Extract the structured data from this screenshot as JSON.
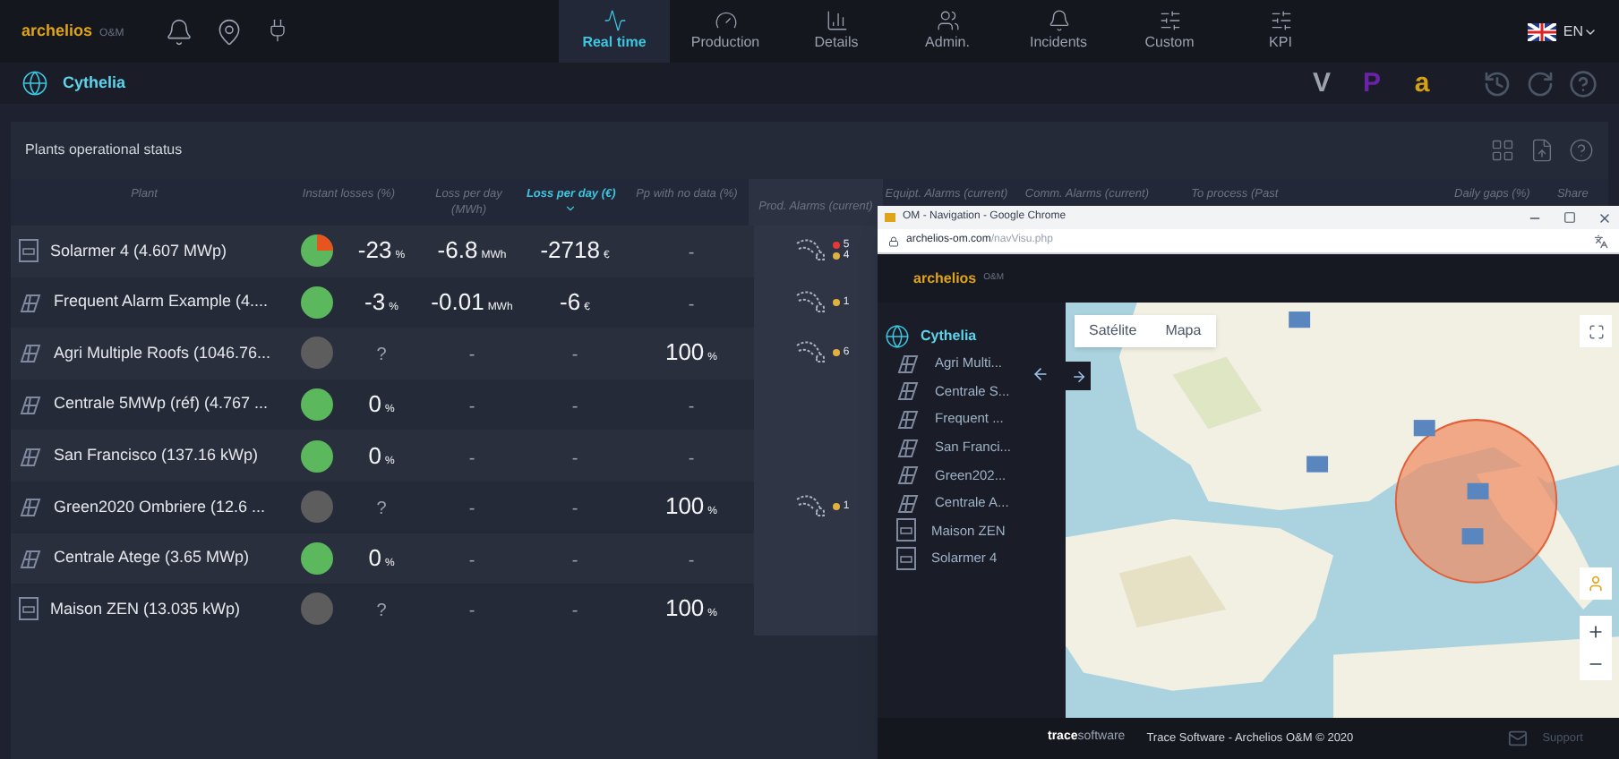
{
  "top_bar": {
    "logo": "archelios",
    "logo_suffix": "O&M",
    "tabs": [
      {
        "label": "Real time",
        "kind": "realtime",
        "selected": true
      },
      {
        "label": "Production",
        "kind": "gauge",
        "selected": false
      },
      {
        "label": "Details",
        "kind": "details",
        "selected": false
      },
      {
        "label": "Admin.",
        "kind": "users",
        "selected": false
      },
      {
        "label": "Incidents",
        "kind": "bell",
        "selected": false
      },
      {
        "label": "Custom",
        "kind": "sliders",
        "selected": false
      },
      {
        "label": "KPI",
        "kind": "sliders",
        "selected": false
      }
    ],
    "language": "EN"
  },
  "sub_bar": {
    "title": "Cythelia",
    "apps": [
      {
        "label": "V",
        "color": "#9ca3af"
      },
      {
        "label": "P",
        "color": "#6b21a8"
      },
      {
        "label": "a",
        "color": "#d4a017"
      }
    ]
  },
  "panel": {
    "title": "Plants operational status",
    "columns": [
      {
        "label": "Plant",
        "sorted": false
      },
      {
        "label": "Instant losses (%)",
        "sorted": false
      },
      {
        "label": "Loss per day (MWh)",
        "sorted": false
      },
      {
        "label": "Loss per day (€)",
        "sorted": true
      },
      {
        "label": "Pp with no data (%)",
        "sorted": false
      },
      {
        "label": "Prod. Alarms (current)",
        "sorted": false
      },
      {
        "label": "Equipt. Alarms (current)",
        "sorted": false
      },
      {
        "label": "Comm. Alarms (current)",
        "sorted": false
      },
      {
        "label": "To process (Past",
        "sorted": false
      },
      {
        "label": "Daily gaps (%)",
        "sorted": false
      },
      {
        "label": "Share",
        "sorted": false
      }
    ],
    "rows": [
      {
        "plant": "Solarmer 4 (4.607 MWp)",
        "kind": "doc",
        "status": {
          "kind": "pie",
          "color": "#5cb85c"
        },
        "instant": {
          "value": "-23",
          "unit": "%"
        },
        "mwh": {
          "value": "-6.8",
          "unit": "MWh"
        },
        "eur": {
          "value": "-2718",
          "unit": "€"
        },
        "nodata": {
          "value": "-"
        },
        "alarms": [
          {
            "count": "5",
            "color": "#e53935"
          },
          {
            "count": "4",
            "color": "#e0b040"
          }
        ]
      },
      {
        "plant": "Frequent Alarm Example (4....",
        "kind": "panels",
        "status": {
          "kind": "dot",
          "color": "#5cb85c"
        },
        "instant": {
          "value": "-3",
          "unit": "%"
        },
        "mwh": {
          "value": "-0.01",
          "unit": "MWh"
        },
        "eur": {
          "value": "-6",
          "unit": "€"
        },
        "nodata": {
          "value": "-"
        },
        "alarms": [
          {
            "count": "1",
            "color": "#e0b040"
          }
        ]
      },
      {
        "plant": "Agri Multiple Roofs (1046.76...",
        "kind": "panels",
        "status": {
          "kind": "dot",
          "color": "#5d5d5d"
        },
        "instant": {
          "value": "?"
        },
        "mwh": {
          "value": "-"
        },
        "eur": {
          "value": "-"
        },
        "nodata": {
          "value": "100",
          "unit": "%"
        },
        "alarms": [
          {
            "count": "6",
            "color": "#e0b040"
          }
        ]
      },
      {
        "plant": "Centrale 5MWp (réf) (4.767 ...",
        "kind": "panels",
        "status": {
          "kind": "dot",
          "color": "#5cb85c"
        },
        "instant": {
          "value": "0",
          "unit": "%"
        },
        "mwh": {
          "value": "-"
        },
        "eur": {
          "value": "-"
        },
        "nodata": {
          "value": "-"
        },
        "alarms": []
      },
      {
        "plant": "San Francisco (137.16 kWp)",
        "kind": "panels",
        "status": {
          "kind": "dot",
          "color": "#5cb85c"
        },
        "instant": {
          "value": "0",
          "unit": "%"
        },
        "mwh": {
          "value": "-"
        },
        "eur": {
          "value": "-"
        },
        "nodata": {
          "value": "-"
        },
        "alarms": []
      },
      {
        "plant": "Green2020 Ombriere (12.6 ...",
        "kind": "panels",
        "status": {
          "kind": "dot",
          "color": "#5d5d5d"
        },
        "instant": {
          "value": "?"
        },
        "mwh": {
          "value": "-"
        },
        "eur": {
          "value": "-"
        },
        "nodata": {
          "value": "100",
          "unit": "%"
        },
        "alarms": [
          {
            "count": "1",
            "color": "#e0b040"
          }
        ]
      },
      {
        "plant": "Centrale Atege (3.65 MWp)",
        "kind": "panels",
        "status": {
          "kind": "dot",
          "color": "#5cb85c"
        },
        "instant": {
          "value": "0",
          "unit": "%"
        },
        "mwh": {
          "value": "-"
        },
        "eur": {
          "value": "-"
        },
        "nodata": {
          "value": "-"
        },
        "alarms": []
      },
      {
        "plant": "Maison ZEN (13.035 kWp)",
        "kind": "doc",
        "status": {
          "kind": "dot",
          "color": "#5d5d5d"
        },
        "instant": {
          "value": "?"
        },
        "mwh": {
          "value": "-"
        },
        "eur": {
          "value": "-"
        },
        "nodata": {
          "value": "100",
          "unit": "%"
        },
        "alarms": []
      }
    ]
  },
  "popup": {
    "title": "OM - Navigation - Google Chrome",
    "url_host": "archelios-om.com",
    "url_path": "/navVisu.php",
    "brand": "archelios",
    "brand_suffix": "O&M",
    "root": "Cythelia",
    "items": [
      {
        "label": "Agri Multi...",
        "kind": "panels"
      },
      {
        "label": "Centrale S...",
        "kind": "panels"
      },
      {
        "label": "Frequent ...",
        "kind": "panels"
      },
      {
        "label": "San Franci...",
        "kind": "panels"
      },
      {
        "label": "Green202...",
        "kind": "panels"
      },
      {
        "label": "Centrale A...",
        "kind": "panels"
      },
      {
        "label": "Maison ZEN",
        "kind": "doc"
      },
      {
        "label": "Solarmer 4",
        "kind": "doc"
      }
    ],
    "map_buttons": [
      "Satélite",
      "Mapa"
    ],
    "footer": {
      "logo_bold": "trace",
      "logo_rest": "software",
      "copyright": "Trace Software - Archelios O&M © 2020",
      "support": "Support"
    }
  }
}
